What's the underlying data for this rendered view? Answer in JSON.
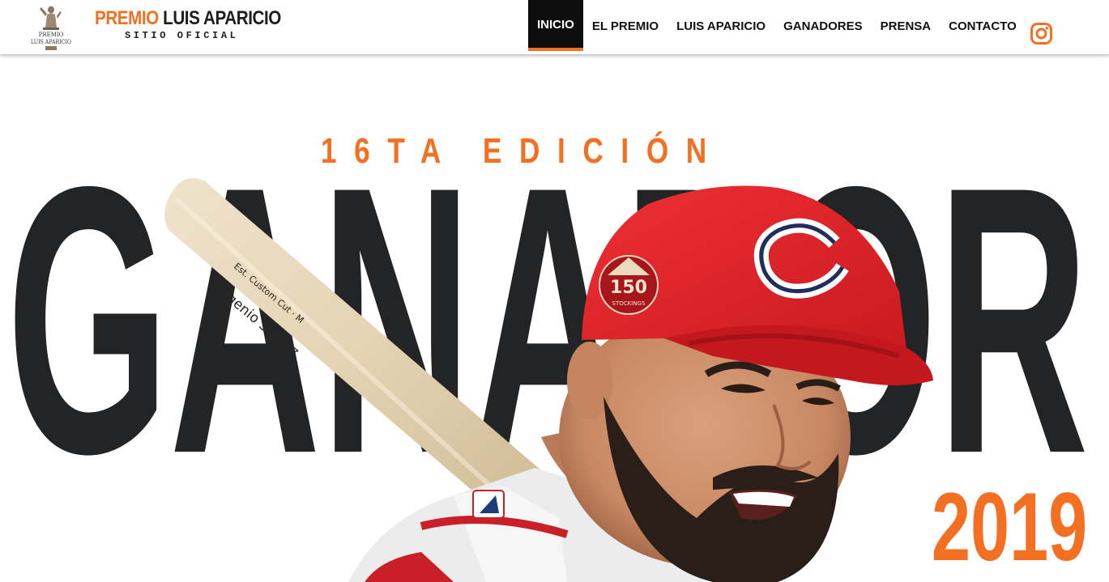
{
  "brand": {
    "logo_alt_lines": [
      "PREMIO",
      "LUIS APARICIO"
    ],
    "title_part1": "PREMIO",
    "title_part2": " LUIS APARICIO",
    "subtitle": "SITIO OFICIAL"
  },
  "nav": {
    "items": [
      {
        "label": "INICIO",
        "active": true
      },
      {
        "label": "EL PREMIO",
        "active": false
      },
      {
        "label": "LUIS APARICIO",
        "active": false
      },
      {
        "label": "GANADORES",
        "active": false
      },
      {
        "label": "PRENSA",
        "active": false
      },
      {
        "label": "CONTACTO",
        "active": false
      }
    ],
    "social_icon": "instagram-icon"
  },
  "hero": {
    "edition": "16TA EDICIÓN",
    "headline": "GANADOR",
    "year": "2019",
    "bat_text_line1": "Eugenio Suarez",
    "bat_text_line2": "Est. Custom Cut · M",
    "cap_patch_text": "150",
    "cap_patch_sub": "STOCKINGS"
  },
  "colors": {
    "accent": "#f36f21",
    "dark": "#222426",
    "nav_active_bg": "#0e0e0e",
    "cap_red": "#e3242b"
  }
}
